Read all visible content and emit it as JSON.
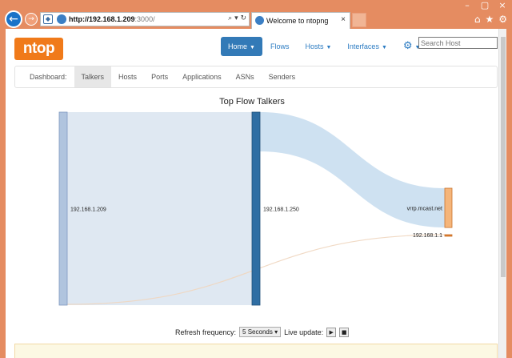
{
  "browser": {
    "url_host": "http://192.168.1.209",
    "url_rest": ":3000/",
    "tab_title": "Welcome to ntopng",
    "back_icon": "←",
    "forward_icon": "→",
    "home_icon": "⌂",
    "star_icon": "★",
    "gear_icon": "⚙",
    "close_icon": "×"
  },
  "header": {
    "logo": "ntop",
    "nav": [
      {
        "label": "Home"
      },
      {
        "label": "Flows"
      },
      {
        "label": "Hosts"
      },
      {
        "label": "Interfaces"
      }
    ],
    "search_placeholder": "Search Host"
  },
  "subnav": {
    "items": [
      {
        "label": "Dashboard:"
      },
      {
        "label": "Talkers"
      },
      {
        "label": "Hosts"
      },
      {
        "label": "Ports"
      },
      {
        "label": "Applications"
      },
      {
        "label": "ASNs"
      },
      {
        "label": "Senders"
      }
    ]
  },
  "chart_title": "Top Flow Talkers",
  "chart_data": {
    "type": "sankey",
    "nodes": [
      {
        "name": "192.168.1.209",
        "color": "#b0c4de"
      },
      {
        "name": "192.168.1.250",
        "color": "#2f6ea3"
      },
      {
        "name": "vrrp.mcast.net",
        "color": "#f5b57a"
      },
      {
        "name": "192.168.1.1",
        "color": "#e07a2a"
      }
    ],
    "links": [
      {
        "source": "192.168.1.209",
        "target": "192.168.1.250",
        "value": 100
      },
      {
        "source": "192.168.1.250",
        "target": "vrrp.mcast.net",
        "value": 21
      },
      {
        "source": "192.168.1.209",
        "target": "192.168.1.1",
        "value": 0.3
      }
    ]
  },
  "refresh": {
    "label": "Refresh frequency:",
    "value": "5 Seconds",
    "live_label": "Live update:"
  }
}
